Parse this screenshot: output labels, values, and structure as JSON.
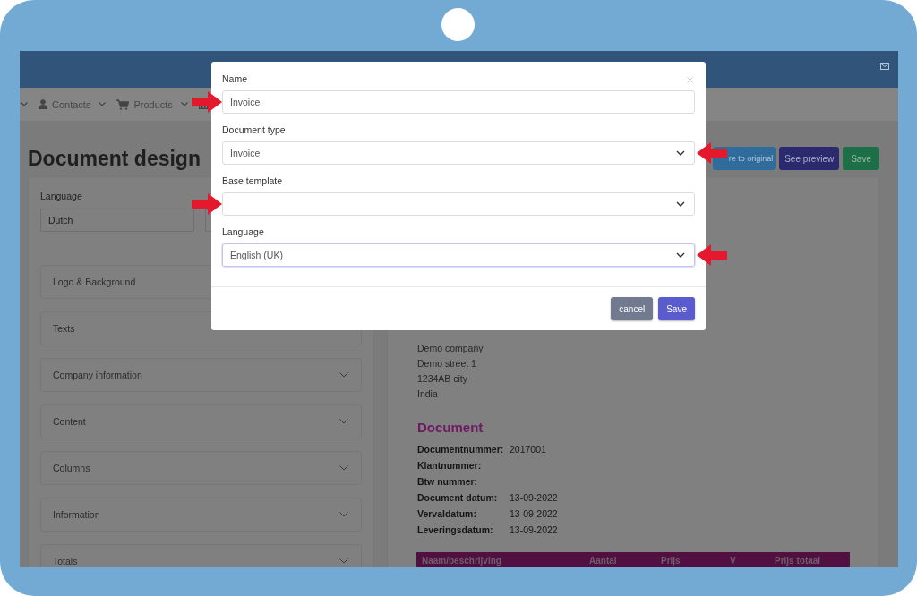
{
  "nav": [
    {
      "kind": "lead"
    },
    {
      "kind": "contacts",
      "label": "Contacts"
    },
    {
      "kind": "products",
      "label": "Products"
    },
    {
      "kind": "reports"
    }
  ],
  "page": {
    "title": "Document design",
    "actions": [
      {
        "kind": "restore",
        "label": "re to original"
      },
      {
        "kind": "preview",
        "label": "See preview"
      },
      {
        "kind": "save",
        "label": "Save"
      }
    ],
    "language_field": {
      "label": "Language",
      "value": "Dutch"
    },
    "sections": [
      {
        "label": "Logo & Background"
      },
      {
        "label": "Texts"
      },
      {
        "label": "Company information"
      },
      {
        "label": "Content"
      },
      {
        "label": "Columns"
      },
      {
        "label": "Information"
      },
      {
        "label": "Totals"
      }
    ]
  },
  "preview": {
    "address_lines": [
      "Demo company",
      "Demo street 1",
      "1234AB city",
      "India"
    ],
    "heading": "Document",
    "fields": [
      {
        "label": "Documentnummer:",
        "value": "2017001"
      },
      {
        "label": "Klantnummer:"
      },
      {
        "label": "Btw nummer:"
      },
      {
        "label": "Document datum:",
        "value": "13-09-2022"
      },
      {
        "label": "Vervaldatum:",
        "value": "13-09-2022"
      },
      {
        "label": "Leveringsdatum:",
        "value": "13-09-2022"
      }
    ],
    "table_columns": [
      "Naam/beschrijving",
      "Aantal",
      "Prijs",
      "V",
      "Prijs totaal"
    ]
  },
  "modal": {
    "fields": [
      {
        "label": "Name",
        "kind": "text",
        "value": "Invoice",
        "focused": false,
        "arrow_left": true,
        "arrow_right": false
      },
      {
        "label": "Document type",
        "kind": "select",
        "value": "Invoice",
        "focused": false,
        "arrow_left": false,
        "arrow_right": true
      },
      {
        "label": "Base template",
        "kind": "select",
        "focused": false,
        "arrow_left": true,
        "arrow_right": false
      },
      {
        "label": "Language",
        "kind": "select",
        "value": "English (UK)",
        "focused": true,
        "arrow_left": false,
        "arrow_right": true
      }
    ],
    "buttons": [
      {
        "kind": "cancel",
        "label": "cancel"
      },
      {
        "kind": "save",
        "label": "Save"
      }
    ]
  }
}
